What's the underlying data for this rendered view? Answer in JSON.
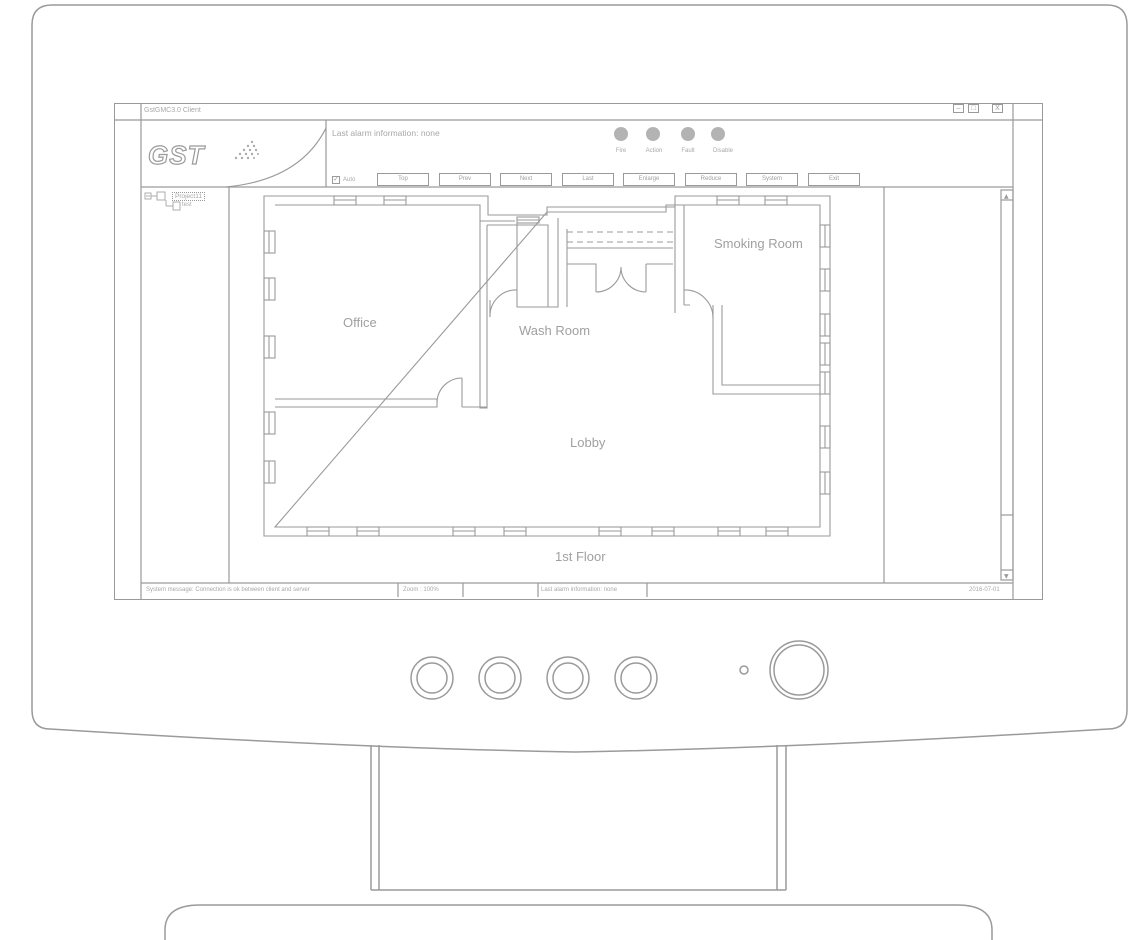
{
  "window": {
    "title": "GstGMC3.0 Client",
    "logo_text": "GST",
    "controls": {
      "minimize": "–",
      "maximize": "□",
      "close": "X"
    }
  },
  "header": {
    "last_alarm": "Last alarm information: none",
    "indicators": [
      {
        "label": "Fire"
      },
      {
        "label": "Action"
      },
      {
        "label": "Fault"
      },
      {
        "label": "Disable"
      }
    ],
    "auto_label": "Auto",
    "auto_checked": true
  },
  "toolbar": {
    "buttons": [
      "Top",
      "Prev",
      "Next",
      "Last",
      "Enlarge",
      "Reduce",
      "System",
      "Exit"
    ]
  },
  "tree": {
    "project": "Project11",
    "child": "test"
  },
  "floorplan": {
    "rooms": [
      "Office",
      "Wash Room",
      "Smoking Room",
      "Lobby"
    ],
    "floor_label": "1st Floor"
  },
  "statusbar": {
    "system_message": "System message: Connection is ok between client and server",
    "zoom": "Zoom : 100%",
    "last_alarm": "Last alarm information: none",
    "date": "2016-07-01"
  },
  "colors": {
    "line": "#9a9a9a",
    "indicator": "#b3b3b3"
  }
}
